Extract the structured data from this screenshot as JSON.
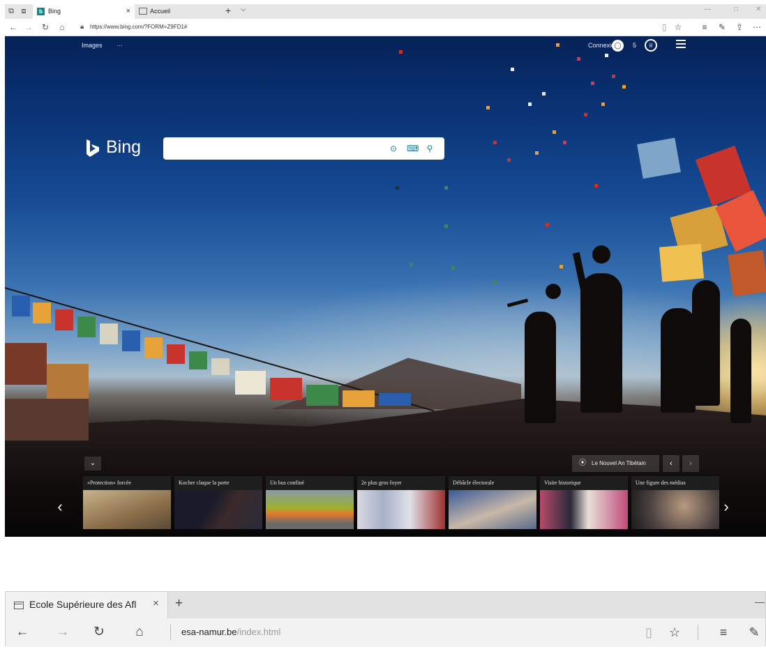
{
  "browser1": {
    "tabs": [
      {
        "label": "Bing",
        "close": "×"
      },
      {
        "label": "Accueil"
      }
    ],
    "new_tab": "+",
    "tab_menu": "⌵",
    "url": "https://www.bing.com/?FORM=Z9FD1#",
    "page": {
      "nav_images": "Images",
      "nav_more": "···",
      "signin_label": "Connexion",
      "rewards_count": "5",
      "logo_text": "Bing",
      "location_label": "Le Nouvel An Tibétain",
      "cards": [
        {
          "title": "«Protection» forcée"
        },
        {
          "title": "Kocher claque la porte"
        },
        {
          "title": "Un bus confiné"
        },
        {
          "title": "2e plus gros foyer"
        },
        {
          "title": "Débâcle électorale"
        },
        {
          "title": "Visite historique"
        },
        {
          "title": "Une figure des médias"
        }
      ]
    }
  },
  "browser2": {
    "tab_label": "Ecole Supérieure des Afl",
    "tab_close": "×",
    "new_tab": "+",
    "url_domain": "esa-namur.be",
    "url_path": "/index.html"
  },
  "colors": {
    "bing_teal": "#0a8a8a",
    "sky_top": "#062257",
    "sky_horizon": "#a6bccd"
  }
}
